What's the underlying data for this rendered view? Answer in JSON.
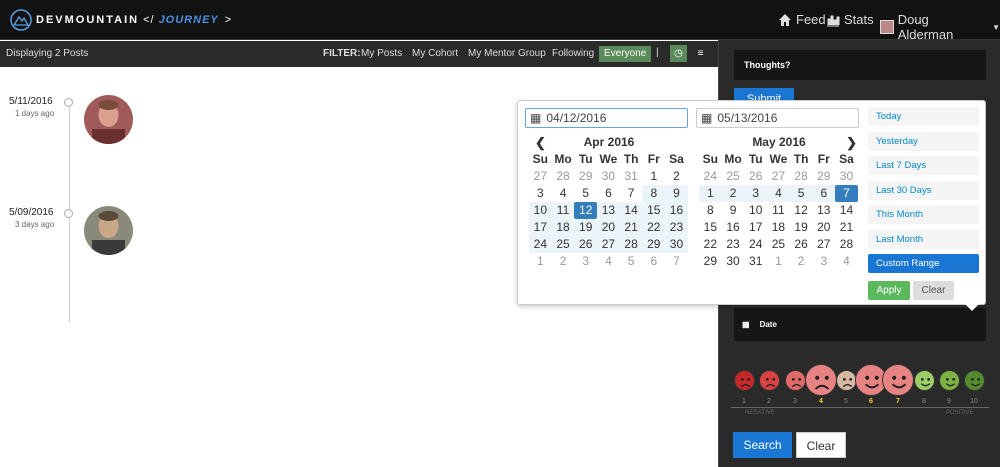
{
  "brand": {
    "part1": "DEVMOUNTAIN",
    "part2": "</",
    "part3": "JOURNEY",
    "part4": ">"
  },
  "nav": {
    "feed": "Feed",
    "stats": "Stats",
    "user": "Doug Alderman"
  },
  "subbar": {
    "displaying": "Displaying 2 Posts",
    "filter_label": "FILTER:",
    "filters": [
      "My Posts",
      "My Cohort",
      "My Mentor Group",
      "Following",
      "Everyone"
    ],
    "active_filter": "Everyone",
    "separator": "|"
  },
  "posts": [
    {
      "date": "5/11/2016",
      "ago": "1 days ago"
    },
    {
      "date": "5/09/2016",
      "ago": "3 days ago"
    }
  ],
  "sidebar": {
    "thoughts": "Thoughts?",
    "submit": "Submit",
    "date_label": "Date",
    "search": "Search",
    "clear": "Clear",
    "negative": "NEGATIVE",
    "positive": "POSITIVE"
  },
  "mood": {
    "numbers": [
      "1",
      "2",
      "3",
      "4",
      "5",
      "6",
      "7",
      "8",
      "9",
      "10"
    ],
    "highlighted": [
      "4",
      "6",
      "7"
    ],
    "colors": [
      "#c62828",
      "#d84343",
      "#e06a6a",
      "#e88383",
      "#d8b8a0",
      "#e88383",
      "#e88383",
      "#9ccc65",
      "#7cb342",
      "#558b2f"
    ]
  },
  "daterange": {
    "start": "04/12/2016",
    "end": "05/13/2016",
    "dow": [
      "Su",
      "Mo",
      "Tu",
      "We",
      "Th",
      "Fr",
      "Sa"
    ],
    "left": {
      "title": "Apr 2016",
      "days": [
        "27",
        "28",
        "29",
        "30",
        "31",
        "1",
        "2",
        "3",
        "4",
        "5",
        "6",
        "7",
        "8",
        "9",
        "10",
        "11",
        "12",
        "13",
        "14",
        "15",
        "16",
        "17",
        "18",
        "19",
        "20",
        "21",
        "22",
        "23",
        "24",
        "25",
        "26",
        "27",
        "28",
        "29",
        "30",
        "1",
        "2",
        "3",
        "4",
        "5",
        "6",
        "7"
      ]
    },
    "right": {
      "title": "May 2016",
      "days": [
        "24",
        "25",
        "26",
        "27",
        "28",
        "29",
        "30",
        "1",
        "2",
        "3",
        "4",
        "5",
        "6",
        "7",
        "8",
        "9",
        "10",
        "11",
        "12",
        "13",
        "14",
        "15",
        "16",
        "17",
        "18",
        "19",
        "20",
        "21",
        "22",
        "23",
        "24",
        "25",
        "26",
        "27",
        "28",
        "29",
        "30",
        "31",
        "1",
        "2",
        "3",
        "4"
      ]
    },
    "ranges": [
      "Today",
      "Yesterday",
      "Last 7 Days",
      "Last 30 Days",
      "This Month",
      "Last Month",
      "Custom Range"
    ],
    "active_range": "Custom Range",
    "apply": "Apply",
    "clear": "Clear"
  }
}
